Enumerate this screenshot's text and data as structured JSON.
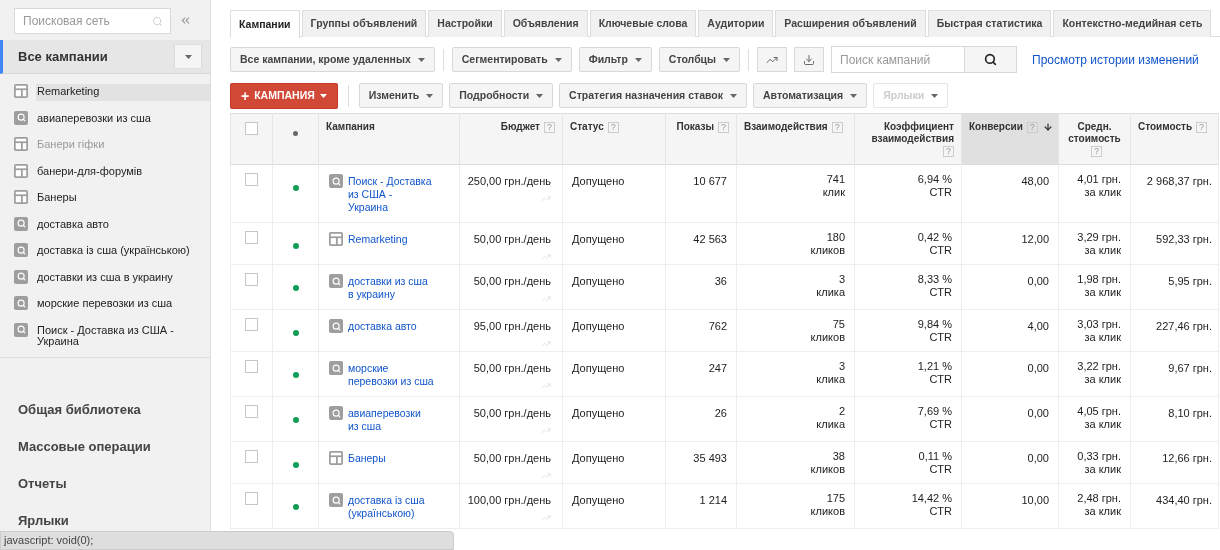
{
  "sidebar": {
    "search": {
      "placeholder": "Поисковая сеть"
    },
    "all_campaigns": "Все кампании",
    "campaigns": [
      {
        "name": "Remarketing",
        "kind": "display",
        "selected": true,
        "disabled": false
      },
      {
        "name": "авиаперевозки из сша",
        "kind": "search",
        "selected": false,
        "disabled": false
      },
      {
        "name": "Банери гіфки",
        "kind": "display",
        "selected": false,
        "disabled": true
      },
      {
        "name": "банери-для-форумів",
        "kind": "display",
        "selected": false,
        "disabled": false
      },
      {
        "name": "Банеры",
        "kind": "display",
        "selected": false,
        "disabled": false
      },
      {
        "name": "доставка авто",
        "kind": "search",
        "selected": false,
        "disabled": false
      },
      {
        "name": "доставка із сша (українською)",
        "kind": "search",
        "selected": false,
        "disabled": false
      },
      {
        "name": "доставки из сша в украину",
        "kind": "search",
        "selected": false,
        "disabled": false
      },
      {
        "name": "морские перевозки из сша",
        "kind": "search",
        "selected": false,
        "disabled": false
      },
      {
        "name": "Поиск - Доставка из США - Украина",
        "kind": "search",
        "selected": false,
        "disabled": false
      }
    ],
    "nav": [
      "Общая библиотека",
      "Массовые операции",
      "Отчеты",
      "Ярлыки"
    ]
  },
  "tabs": [
    {
      "label": "Кампании",
      "selected": true
    },
    {
      "label": "Группы объявлений",
      "selected": false
    },
    {
      "label": "Настройки",
      "selected": false
    },
    {
      "label": "Объявления",
      "selected": false
    },
    {
      "label": "Ключевые слова",
      "selected": false
    },
    {
      "label": "Аудитории",
      "selected": false
    },
    {
      "label": "Расширения объявлений",
      "selected": false
    },
    {
      "label": "Быстрая статистика",
      "selected": false
    },
    {
      "label": "Контекстно-медийная сеть",
      "selected": false
    }
  ],
  "toolbar": {
    "view": "Все кампании, кроме удаленных",
    "buttons": [
      "Сегментировать",
      "Фильтр",
      "Столбцы"
    ],
    "search": {
      "placeholder": "Поиск кампаний"
    },
    "history_link": "Просмотр истории изменений"
  },
  "actions": {
    "add": {
      "plus": "+",
      "label": "КАМПАНИЯ"
    },
    "buttons": [
      {
        "label": "Изменить",
        "disabled": false
      },
      {
        "label": "Подробности",
        "disabled": false
      },
      {
        "label": "Стратегия назначения ставок",
        "disabled": false
      },
      {
        "label": "Автоматизация",
        "disabled": false
      },
      {
        "label": "Ярлыки",
        "disabled": true
      }
    ]
  },
  "table": {
    "help_mark": "?",
    "select_all_checked": false,
    "columns": [
      {
        "label": "Кампания",
        "help": false,
        "sorted": false
      },
      {
        "label": "Бюджет",
        "help": true,
        "sorted": false
      },
      {
        "label": "Статус",
        "help": true,
        "sorted": false
      },
      {
        "label": "Показы",
        "help": true,
        "sorted": false
      },
      {
        "label": "Взаимодействия",
        "help": true,
        "sorted": false
      },
      {
        "label": "Коэффициент взаимодействия",
        "help": true,
        "sorted": false
      },
      {
        "label": "Конверсии",
        "help": true,
        "sorted": true
      },
      {
        "label": "Средн. стоимость",
        "help": true,
        "sorted": false
      },
      {
        "label": "Стоимость",
        "help": true,
        "sorted": false
      }
    ],
    "rows": [
      {
        "checked": false,
        "color": "#0f9d58",
        "kind": "search",
        "campaign": "Поиск - Доставка из США - Украина",
        "budget": "250,00 грн./день",
        "status": "Допущено",
        "impressions": "10 677",
        "interactions": "741",
        "interactions_unit": "клик",
        "rate": "6,94 %",
        "rate_unit": "CTR",
        "conversions": "48,00",
        "avg_cost": "4,01 грн.",
        "avg_unit": "за клик",
        "cost": "2 968,37 грн."
      },
      {
        "checked": false,
        "color": "#0f9d58",
        "kind": "display",
        "campaign": "Remarketing",
        "budget": "50,00 грн./день",
        "status": "Допущено",
        "impressions": "42 563",
        "interactions": "180",
        "interactions_unit": "кликов",
        "rate": "0,42 %",
        "rate_unit": "CTR",
        "conversions": "12,00",
        "avg_cost": "3,29 грн.",
        "avg_unit": "за клик",
        "cost": "592,33 грн."
      },
      {
        "checked": false,
        "color": "#0f9d58",
        "kind": "search",
        "campaign": "доставки из сша в украину",
        "budget": "50,00 грн./день",
        "status": "Допущено",
        "impressions": "36",
        "interactions": "3",
        "interactions_unit": "клика",
        "rate": "8,33 %",
        "rate_unit": "CTR",
        "conversions": "0,00",
        "avg_cost": "1,98 грн.",
        "avg_unit": "за клик",
        "cost": "5,95 грн."
      },
      {
        "checked": false,
        "color": "#0f9d58",
        "kind": "search",
        "campaign": "доставка авто",
        "budget": "95,00 грн./день",
        "status": "Допущено",
        "impressions": "762",
        "interactions": "75",
        "interactions_unit": "кликов",
        "rate": "9,84 %",
        "rate_unit": "CTR",
        "conversions": "4,00",
        "avg_cost": "3,03 грн.",
        "avg_unit": "за клик",
        "cost": "227,46 грн."
      },
      {
        "checked": false,
        "color": "#0f9d58",
        "kind": "search",
        "campaign": "морские перевозки из сша",
        "budget": "50,00 грн./день",
        "status": "Допущено",
        "impressions": "247",
        "interactions": "3",
        "interactions_unit": "клика",
        "rate": "1,21 %",
        "rate_unit": "CTR",
        "conversions": "0,00",
        "avg_cost": "3,22 грн.",
        "avg_unit": "за клик",
        "cost": "9,67 грн."
      },
      {
        "checked": false,
        "color": "#0f9d58",
        "kind": "search",
        "campaign": "авиаперевозки из сша",
        "budget": "50,00 грн./день",
        "status": "Допущено",
        "impressions": "26",
        "interactions": "2",
        "interactions_unit": "клика",
        "rate": "7,69 %",
        "rate_unit": "CTR",
        "conversions": "0,00",
        "avg_cost": "4,05 грн.",
        "avg_unit": "за клик",
        "cost": "8,10 грн."
      },
      {
        "checked": false,
        "color": "#0f9d58",
        "kind": "display",
        "campaign": "Банеры",
        "budget": "50,00 грн./день",
        "status": "Допущено",
        "impressions": "35 493",
        "interactions": "38",
        "interactions_unit": "кликов",
        "rate": "0,11 %",
        "rate_unit": "CTR",
        "conversions": "0,00",
        "avg_cost": "0,33 грн.",
        "avg_unit": "за клик",
        "cost": "12,66 грн."
      },
      {
        "checked": false,
        "color": "#0f9d58",
        "kind": "search",
        "campaign": "доставка із сша (українською)",
        "budget": "100,00 грн./день",
        "status": "Допущено",
        "impressions": "1 214",
        "interactions": "175",
        "interactions_unit": "кликов",
        "rate": "14,42 %",
        "rate_unit": "CTR",
        "conversions": "10,00",
        "avg_cost": "2,48 грн.",
        "avg_unit": "за клик",
        "cost": "434,40 грн."
      }
    ]
  },
  "status_bar": "javascript: void(0);"
}
